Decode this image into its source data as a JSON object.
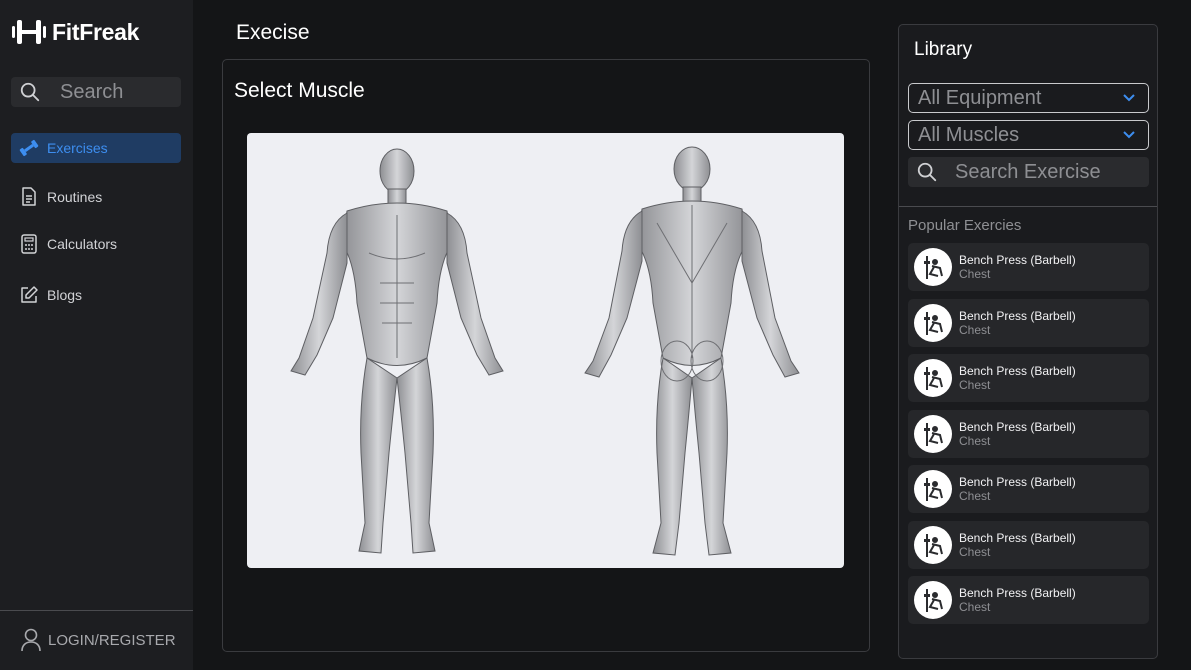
{
  "app": {
    "name": "FitFreak"
  },
  "sidebar": {
    "search_placeholder": "Search",
    "items": [
      {
        "label": "Exercises",
        "icon": "dumbbell-icon",
        "active": true
      },
      {
        "label": "Routines",
        "icon": "document-icon",
        "active": false
      },
      {
        "label": "Calculators",
        "icon": "calculator-icon",
        "active": false
      },
      {
        "label": "Blogs",
        "icon": "edit-icon",
        "active": false
      }
    ],
    "login_label": "LOGIN/REGISTER"
  },
  "main": {
    "title": "Execise",
    "panel_title": "Select Muscle"
  },
  "library": {
    "title": "Library",
    "equipment_select": "All Equipment",
    "muscles_select": "All Muscles",
    "search_placeholder": "Search Exercise",
    "popular_title": "Popular Exercies",
    "exercises": [
      {
        "name": "Bench Press (Barbell)",
        "category": "Chest"
      },
      {
        "name": "Bench Press (Barbell)",
        "category": "Chest"
      },
      {
        "name": "Bench Press (Barbell)",
        "category": "Chest"
      },
      {
        "name": "Bench Press (Barbell)",
        "category": "Chest"
      },
      {
        "name": "Bench Press (Barbell)",
        "category": "Chest"
      },
      {
        "name": "Bench Press (Barbell)",
        "category": "Chest"
      },
      {
        "name": "Bench Press (Barbell)",
        "category": "Chest"
      }
    ]
  },
  "colors": {
    "accent": "#3d8ef0",
    "active_bg": "#1f3c63",
    "background": "#141517",
    "sidebar": "#1d1e21"
  }
}
